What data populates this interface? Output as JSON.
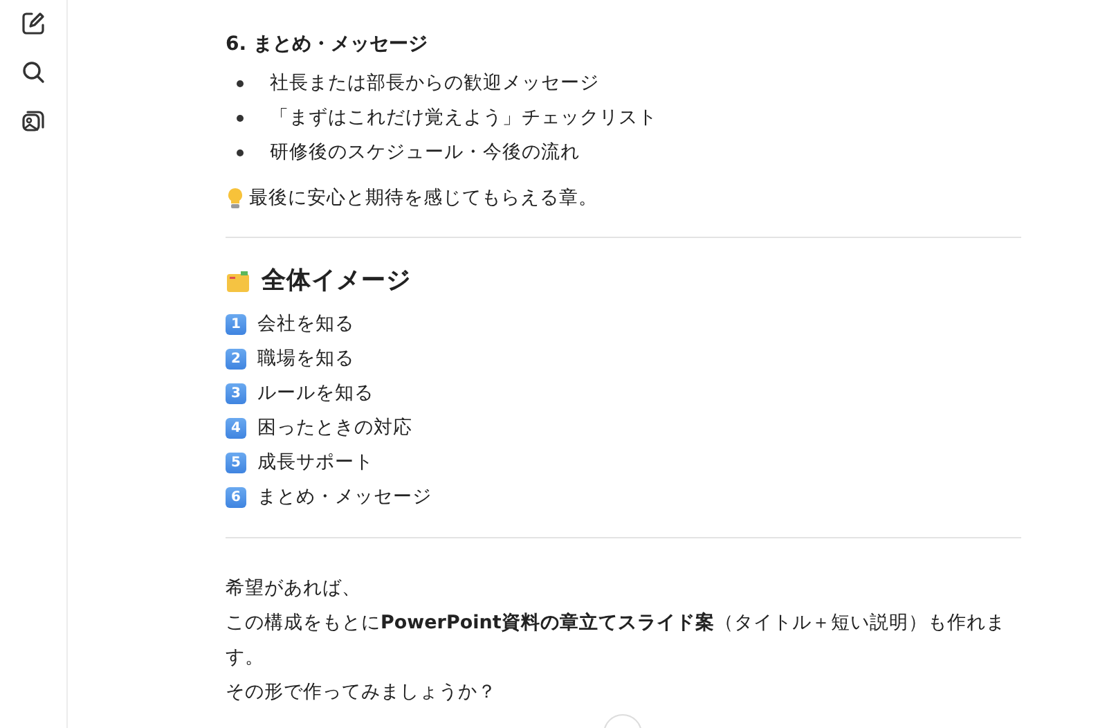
{
  "sidebar": {
    "items": [
      {
        "kind": "edit"
      },
      {
        "kind": "search"
      },
      {
        "kind": "images"
      }
    ]
  },
  "section": {
    "heading": "6. まとめ・メッセージ",
    "bullets": [
      "社長または部長からの歓迎メッセージ",
      "「まずはこれだけ覚えよう」チェックリスト",
      "研修後のスケジュール・今後の流れ"
    ],
    "note": "最後に安心と期待を感じてもらえる章。"
  },
  "overview": {
    "heading": "全体イメージ",
    "items": [
      {
        "number": "1",
        "text": "会社を知る"
      },
      {
        "number": "2",
        "text": "職場を知る"
      },
      {
        "number": "3",
        "text": "ルールを知る"
      },
      {
        "number": "4",
        "text": "困ったときの対応"
      },
      {
        "number": "5",
        "text": "成長サポート"
      },
      {
        "number": "6",
        "text": "まとめ・メッセージ"
      }
    ]
  },
  "closing": [
    "希望があれば、",
    "この構成をもとに**PowerPoint資料の章立てスライド案**（タイトル＋短い説明）も作れます。",
    "その形で作ってみましょうか？"
  ]
}
